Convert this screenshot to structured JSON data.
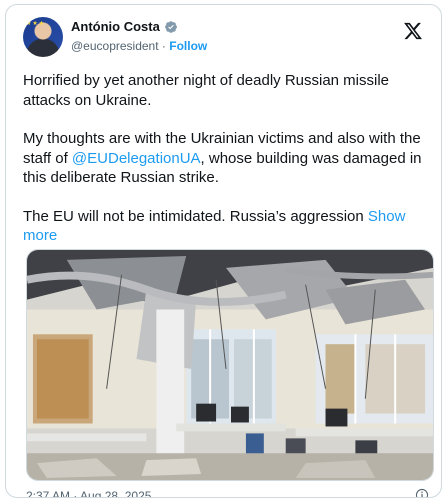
{
  "author": {
    "name": "António Costa",
    "handle": "@eucopresident",
    "separator": "·",
    "follow_label": "Follow"
  },
  "tweet": {
    "paragraph1": "Horrified by yet another night of deadly Russian missile attacks on Ukraine.",
    "paragraph2_before": "My thoughts are with the Ukrainian victims and also with the staff of ",
    "paragraph2_mention": "@EUDelegationUA",
    "paragraph2_after": ", whose building was damaged in this deliberate Russian strike.",
    "paragraph3": "The EU will not be intimidated. Russia’s aggression ",
    "show_more_label": "Show more"
  },
  "footer": {
    "timestamp": "2:37 AM · Aug 28, 2025"
  },
  "icons": {
    "verified": "verified-badge-icon",
    "platform": "x-logo-icon",
    "info": "info-icon"
  },
  "colors": {
    "accent": "#1d9bf0",
    "text": "#0f1419",
    "muted": "#536471",
    "border": "#cfd9de"
  }
}
